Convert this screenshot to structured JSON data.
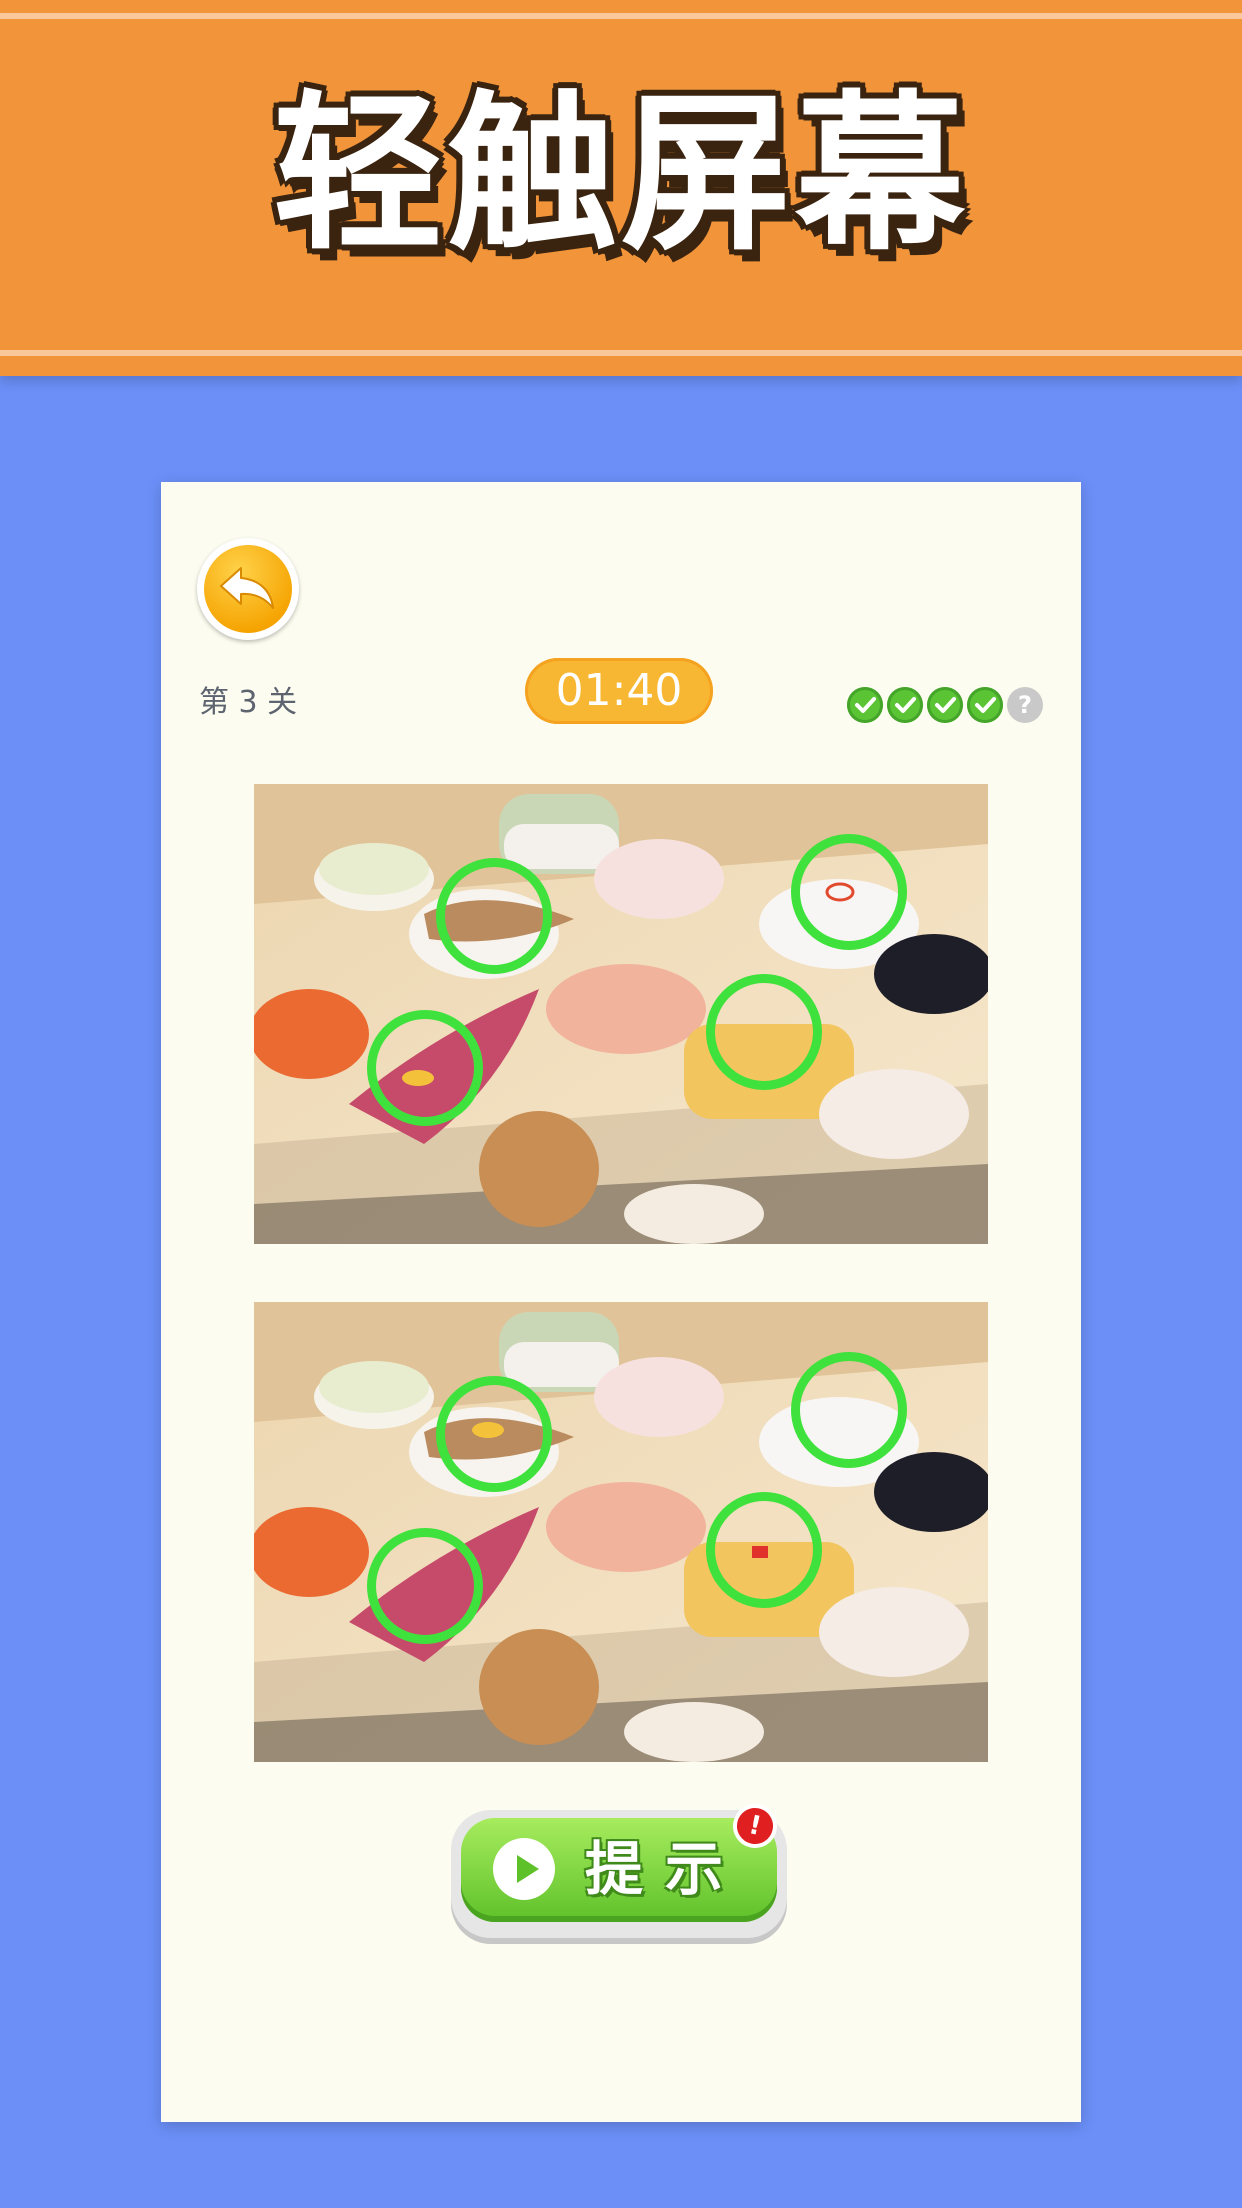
{
  "banner": {
    "title": "轻触屏幕"
  },
  "game": {
    "level": "第 3 关",
    "timer": "01:40",
    "progress": [
      {
        "state": "found",
        "icon": "check-icon"
      },
      {
        "state": "found",
        "icon": "check-icon"
      },
      {
        "state": "found",
        "icon": "check-icon"
      },
      {
        "state": "found",
        "icon": "check-icon"
      },
      {
        "state": "unknown",
        "icon": "question-icon",
        "symbol": "?"
      }
    ],
    "found_differences": 4,
    "back_icon": "back-arrow-icon"
  },
  "hint": {
    "label": "提示",
    "badge": "!",
    "icon": "play-icon"
  },
  "colors": {
    "background": "#6b8ff7",
    "banner": "#f1943a",
    "card": "#fcfcf0",
    "timer": "#f8b733",
    "marker": "#3fe23c",
    "hint_button": "#5ec12a",
    "badge": "#e02020"
  }
}
